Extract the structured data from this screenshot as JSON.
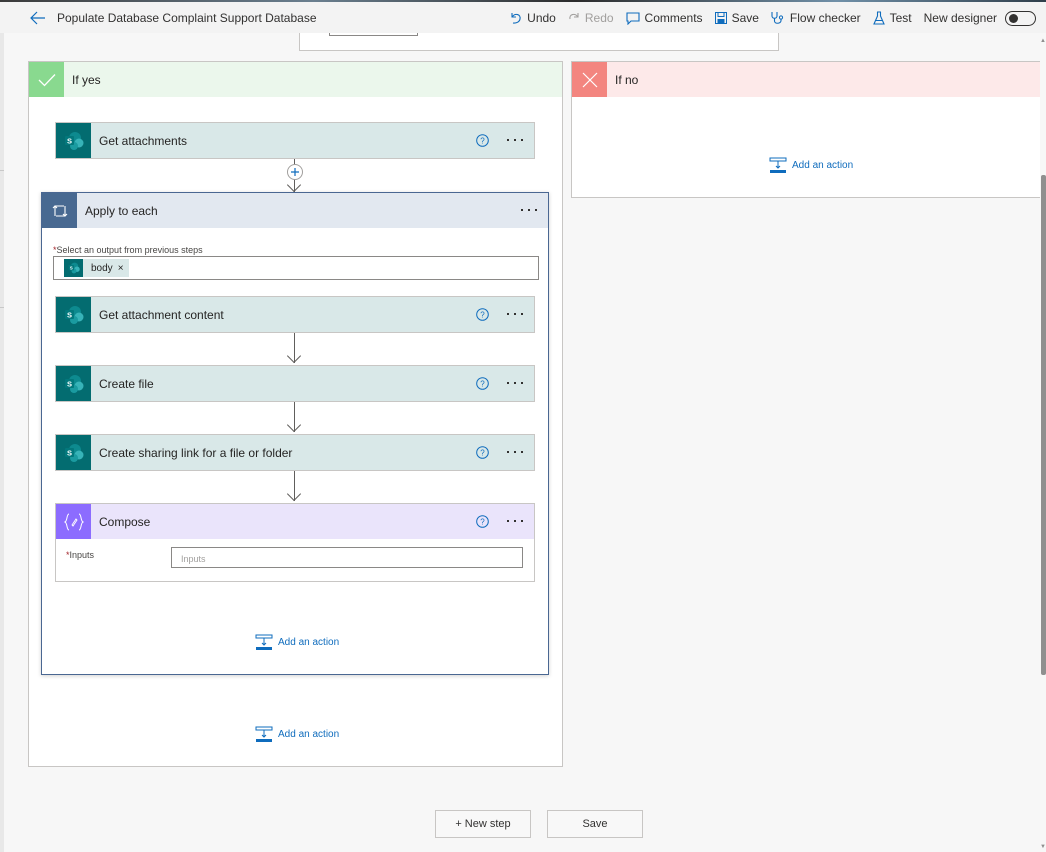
{
  "header": {
    "title": "Populate Database Complaint Support Database",
    "commands": {
      "undo": "Undo",
      "redo": "Redo",
      "comments": "Comments",
      "save": "Save",
      "flow_checker": "Flow checker",
      "test": "Test",
      "new_designer": "New designer"
    },
    "new_designer_enabled": false
  },
  "branches": {
    "yes": {
      "label": "If yes",
      "color": "#89d98f",
      "steps": [
        {
          "title": "Get attachments",
          "connector": "SharePoint"
        }
      ],
      "apply_to_each": {
        "title": "Apply to each",
        "field_label": "Select an output from previous steps",
        "token": "body",
        "steps": [
          {
            "title": "Get attachment content",
            "connector": "SharePoint"
          },
          {
            "title": "Create file",
            "connector": "SharePoint"
          },
          {
            "title": "Create sharing link for a file or folder",
            "connector": "SharePoint"
          }
        ],
        "compose": {
          "title": "Compose",
          "inputs_label": "Inputs",
          "inputs_placeholder": "Inputs"
        },
        "add_action": "Add an action"
      },
      "add_action": "Add an action"
    },
    "no": {
      "label": "If no",
      "color": "#f3857f",
      "add_action": "Add an action"
    }
  },
  "footer": {
    "new_step": "+ New step",
    "save": "Save"
  },
  "colors": {
    "sharepoint": "#036c70",
    "loop": "#486991",
    "compose": "#8c6cff",
    "link": "#0f6cbd"
  }
}
